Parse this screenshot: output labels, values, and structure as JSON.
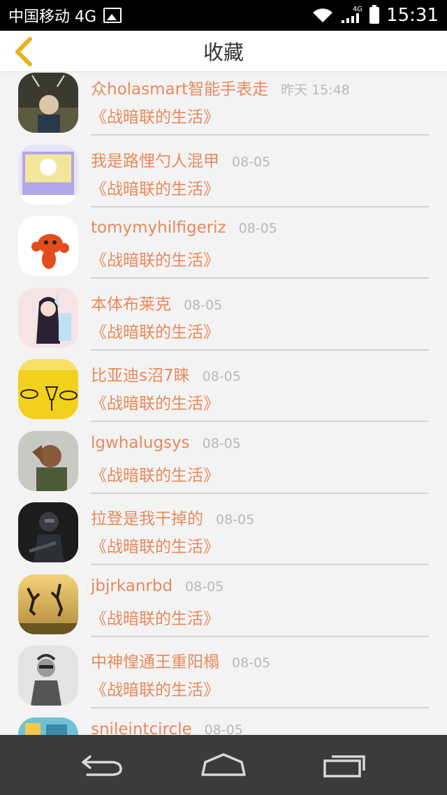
{
  "status_bar": {
    "carrier": "中国移动 4G",
    "network_label": "4G",
    "time": "15:31"
  },
  "header": {
    "title": "收藏",
    "back_icon": "chevron-left-icon"
  },
  "colors": {
    "accent": "#e8895b",
    "back_arrow": "#e8b219",
    "date": "#b9b9b9",
    "background": "#f3f3f3"
  },
  "items": [
    {
      "name": "众holasmart智能手表走",
      "date": "昨天 15:48",
      "title": "《战暗联的生活》"
    },
    {
      "name": "我是路悝勺人混甲",
      "date": "08-05",
      "title": "《战暗联的生活》"
    },
    {
      "name": "tomymyhilfigeriz",
      "date": "08-05",
      "title": "《战暗联的生活》"
    },
    {
      "name": "本体布莱克",
      "date": "08-05",
      "title": "《战暗联的生活》"
    },
    {
      "name": "比亚迪s沼7睐",
      "date": "08-05",
      "title": "《战暗联的生活》"
    },
    {
      "name": "lgwhalugsys",
      "date": "08-05",
      "title": "《战暗联的生活》"
    },
    {
      "name": "拉登是我干掉的",
      "date": "08-05",
      "title": "《战暗联的生活》"
    },
    {
      "name": "jbjrkanrbd",
      "date": "08-05",
      "title": "《战暗联的生活》"
    },
    {
      "name": "中神惶通王重阳榻",
      "date": "08-05",
      "title": "《战暗联的生活》"
    },
    {
      "name": "snileintcircle",
      "date": "08-05",
      "title": ""
    }
  ],
  "nav": {
    "back_icon": "nav-back-icon",
    "home_icon": "nav-home-icon",
    "recents_icon": "nav-recents-icon"
  }
}
